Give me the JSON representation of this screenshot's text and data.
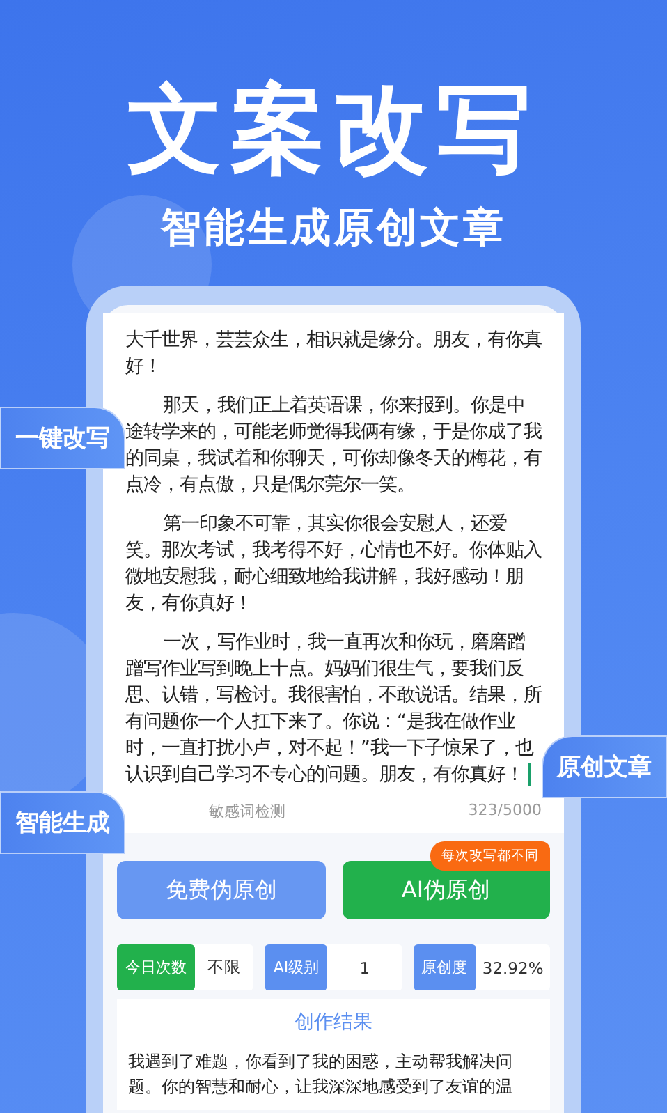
{
  "hero": {
    "title": "文案改写",
    "subtitle": "智能生成原创文章"
  },
  "editor": {
    "paragraphs": [
      {
        "text": "大千世界，芸芸众生，相识就是缘分。朋友，有你真好！",
        "kind": "lead"
      },
      {
        "text": "那天，我们正上着英语课，你来报到。你是中途转学来的，可能老师觉得我俩有缘，于是你成了我的同桌，我试着和你聊天，可你却像冬天的梅花，有点冷，有点傲，只是偶尔莞尔一笑。",
        "kind": "body"
      },
      {
        "text": "第一印象不可靠，其实你很会安慰人，还爱笑。那次考试，我考得不好，心情也不好。你体贴入微地安慰我，耐心细致地给我讲解，我好感动！朋友，有你真好！",
        "kind": "body"
      },
      {
        "text": "一次，写作业时，我一直再次和你玩，磨磨蹭蹭写作业写到晚上十点。妈妈们很生气，要我们反思、认错，写检讨。我很害怕，不敢说话。结果，所有问题你一个人扛下来了。你说：“是我在做作业时，一直打扰小卢，对不起！”我一下子惊呆了，也认识到自己学习不专心的问题。朋友，有你真好！",
        "kind": "body"
      }
    ],
    "footer": {
      "sensitive_check": "敏感词检测",
      "count": "323/5000"
    }
  },
  "badges": [
    "一键改写",
    "原创文章",
    "智能生成"
  ],
  "actions": [
    {
      "label": "免费伪原创",
      "kind": "free"
    },
    {
      "label": "AI伪原创",
      "kind": "ai",
      "tag": "每次改写都不同"
    }
  ],
  "stats": [
    {
      "label": "今日次数",
      "value": "不限",
      "color": "#22b14c"
    },
    {
      "label": "AI级别",
      "value": "1",
      "color": "#5b8ff0"
    },
    {
      "label": "原创度",
      "value": "32.92%",
      "color": "#5b8ff0"
    }
  ],
  "result": {
    "title": "创作结果",
    "text": "我遇到了难题，你看到了我的困惑，主动帮我解决问题。你的智慧和耐心，让我深深地感受到了友谊的温"
  }
}
